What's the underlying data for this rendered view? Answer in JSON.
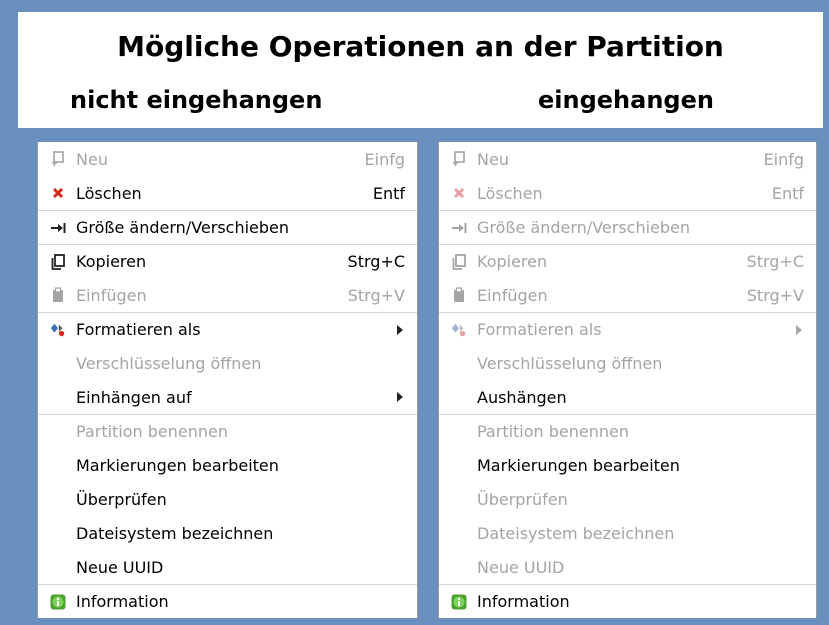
{
  "header": {
    "title": "Mögliche Operationen an der Partition",
    "left_subtitle": "nicht eingehangen",
    "right_subtitle": "eingehangen"
  },
  "left_menu": {
    "items": [
      {
        "label": "Neu",
        "shortcut": "Einfg",
        "icon": "new-icon",
        "disabled": true
      },
      {
        "label": "Löschen",
        "shortcut": "Entf",
        "icon": "delete-icon",
        "disabled": false
      },
      {
        "label": "Größe ändern/Verschieben",
        "shortcut": "",
        "icon": "resize-icon",
        "disabled": false
      },
      {
        "label": "Kopieren",
        "shortcut": "Strg+C",
        "icon": "copy-icon",
        "disabled": false
      },
      {
        "label": "Einfügen",
        "shortcut": "Strg+V",
        "icon": "paste-icon",
        "disabled": true
      },
      {
        "label": "Formatieren als",
        "shortcut": "",
        "icon": "format-icon",
        "disabled": false,
        "submenu": true
      },
      {
        "label": "Verschlüsselung öffnen",
        "shortcut": "",
        "icon": "",
        "disabled": true
      },
      {
        "label": "Einhängen auf",
        "shortcut": "",
        "icon": "",
        "disabled": false,
        "submenu": true
      },
      {
        "label": "Partition benennen",
        "shortcut": "",
        "icon": "",
        "disabled": true
      },
      {
        "label": "Markierungen bearbeiten",
        "shortcut": "",
        "icon": "",
        "disabled": false
      },
      {
        "label": "Überprüfen",
        "shortcut": "",
        "icon": "",
        "disabled": false
      },
      {
        "label": "Dateisystem bezeichnen",
        "shortcut": "",
        "icon": "",
        "disabled": false
      },
      {
        "label": "Neue UUID",
        "shortcut": "",
        "icon": "",
        "disabled": false
      },
      {
        "label": "Information",
        "shortcut": "",
        "icon": "info-icon",
        "disabled": false
      }
    ]
  },
  "right_menu": {
    "items": [
      {
        "label": "Neu",
        "shortcut": "Einfg",
        "icon": "new-icon",
        "disabled": true
      },
      {
        "label": "Löschen",
        "shortcut": "Entf",
        "icon": "delete-icon",
        "disabled": true
      },
      {
        "label": "Größe ändern/Verschieben",
        "shortcut": "",
        "icon": "resize-icon",
        "disabled": true
      },
      {
        "label": "Kopieren",
        "shortcut": "Strg+C",
        "icon": "copy-icon",
        "disabled": true
      },
      {
        "label": "Einfügen",
        "shortcut": "Strg+V",
        "icon": "paste-icon",
        "disabled": true
      },
      {
        "label": "Formatieren als",
        "shortcut": "",
        "icon": "format-icon",
        "disabled": true,
        "submenu": true
      },
      {
        "label": "Verschlüsselung öffnen",
        "shortcut": "",
        "icon": "",
        "disabled": true
      },
      {
        "label": "Aushängen",
        "shortcut": "",
        "icon": "",
        "disabled": false
      },
      {
        "label": "Partition benennen",
        "shortcut": "",
        "icon": "",
        "disabled": true
      },
      {
        "label": "Markierungen bearbeiten",
        "shortcut": "",
        "icon": "",
        "disabled": false
      },
      {
        "label": "Überprüfen",
        "shortcut": "",
        "icon": "",
        "disabled": true
      },
      {
        "label": "Dateisystem bezeichnen",
        "shortcut": "",
        "icon": "",
        "disabled": true
      },
      {
        "label": "Neue UUID",
        "shortcut": "",
        "icon": "",
        "disabled": true
      },
      {
        "label": "Information",
        "shortcut": "",
        "icon": "info-icon",
        "disabled": false
      }
    ]
  },
  "colors": {
    "background": "#6a8fbd",
    "disabled_text": "#a4a4a4",
    "delete_red": "#d42a1a",
    "info_green": "#4aa02c"
  }
}
